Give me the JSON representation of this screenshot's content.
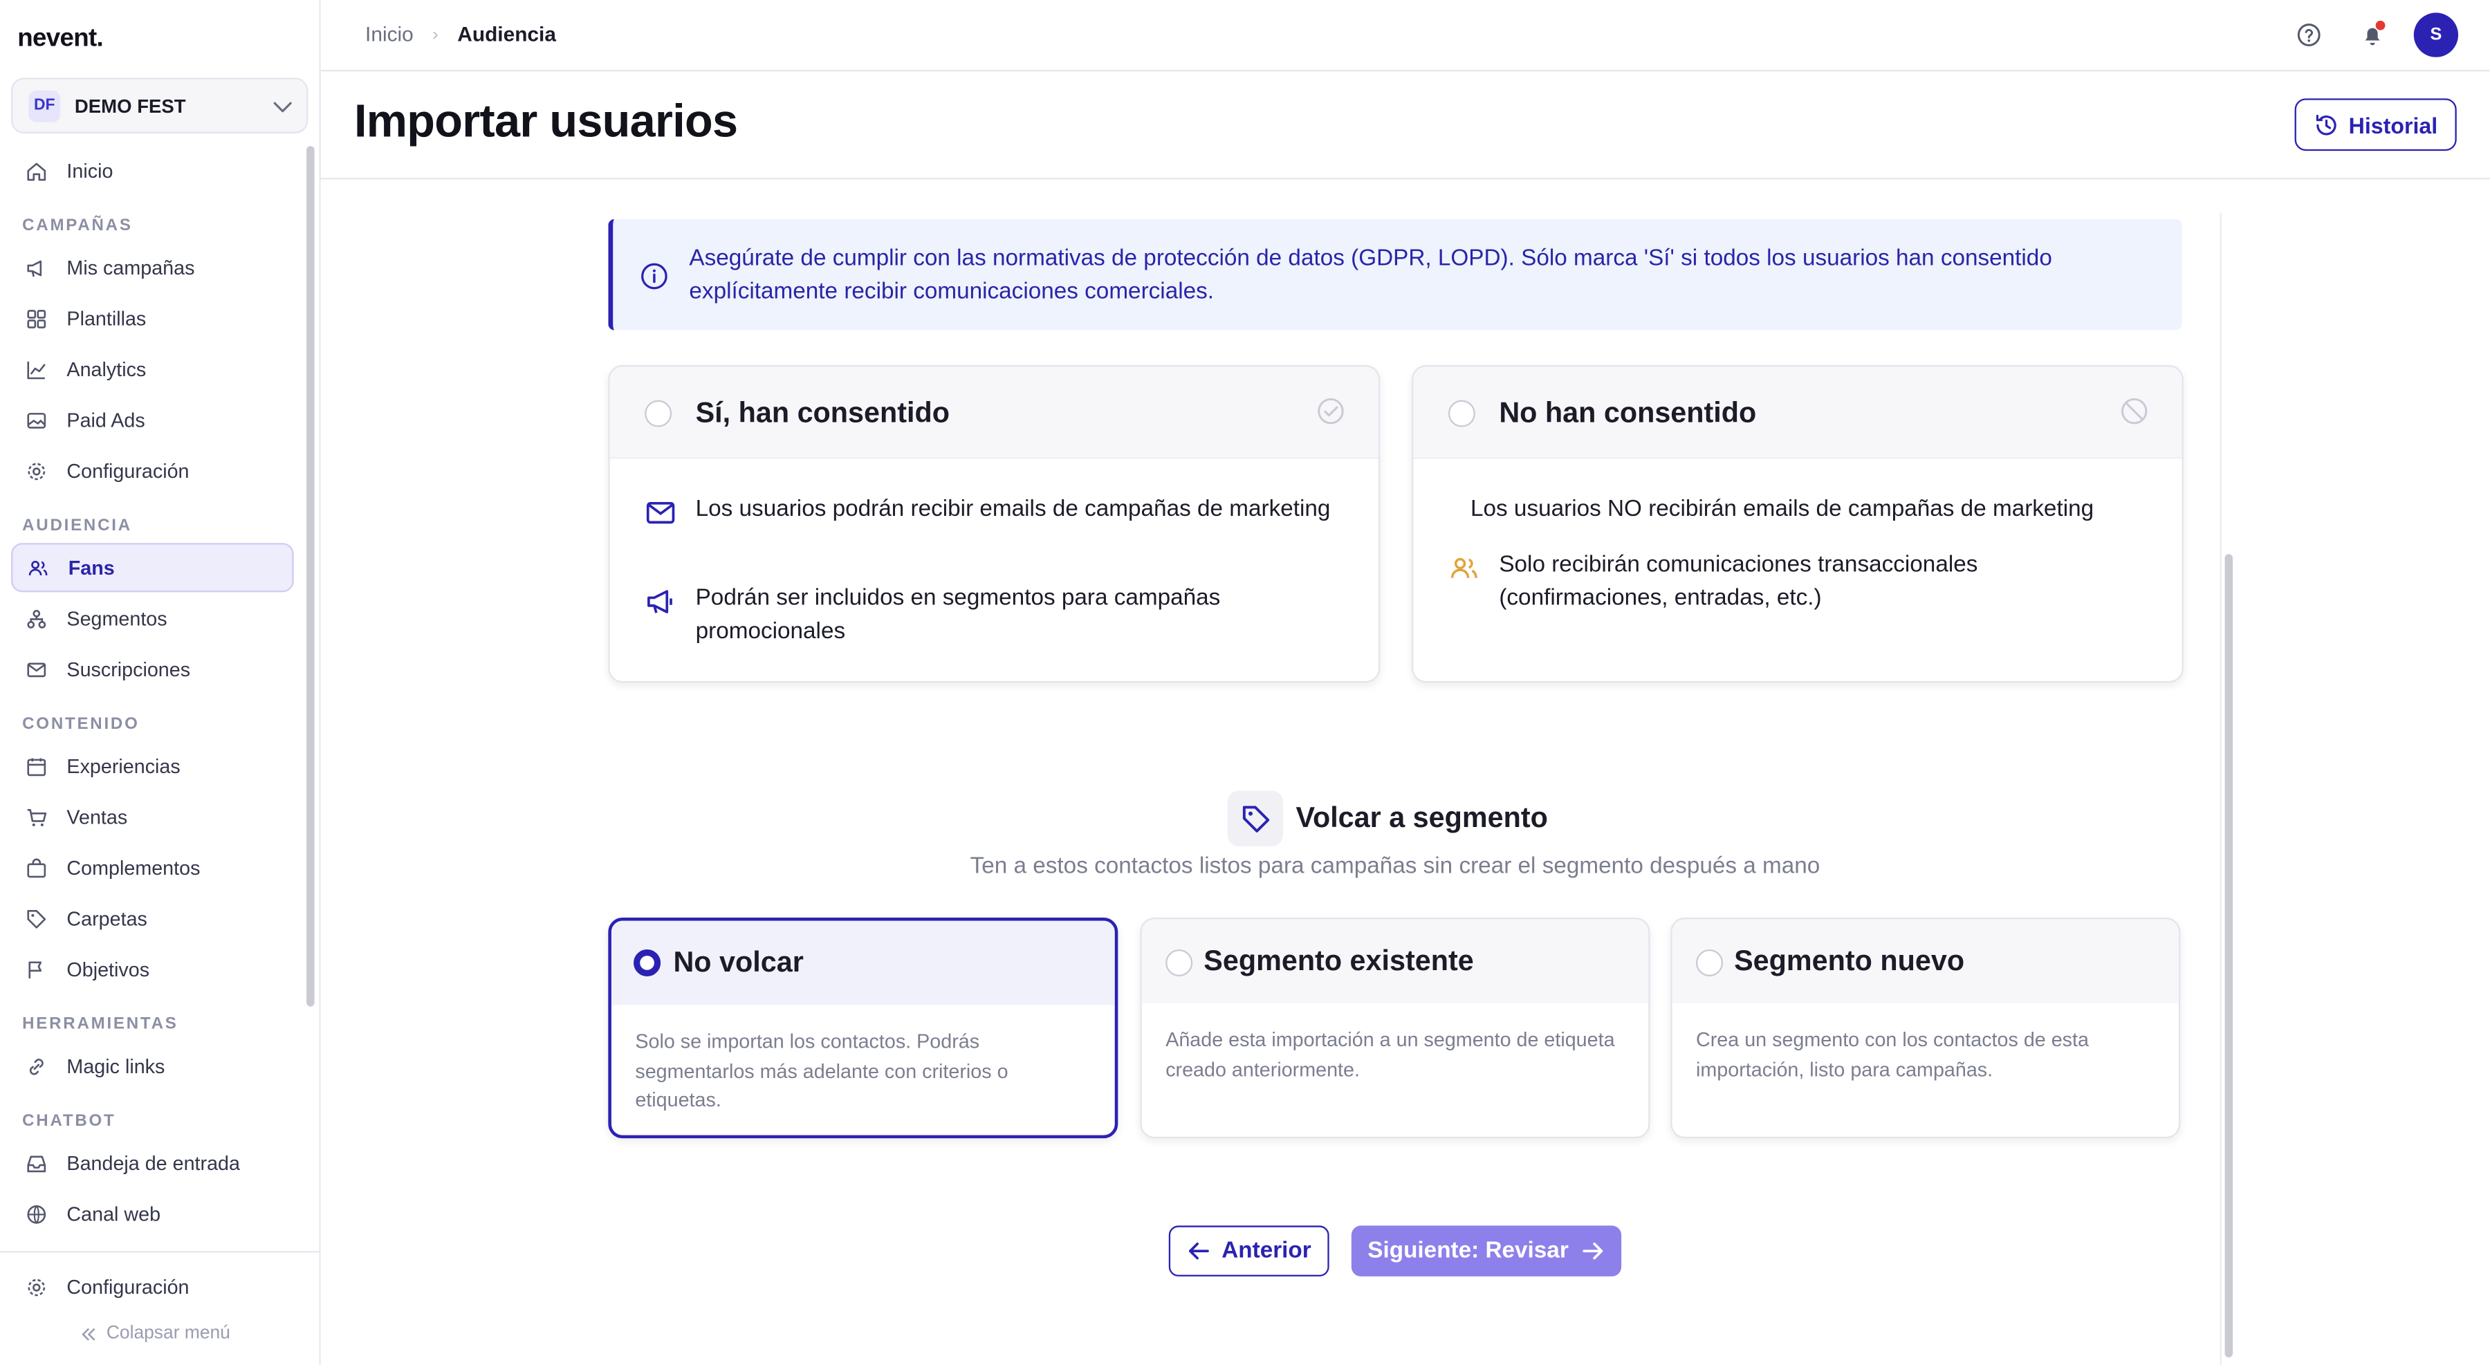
{
  "app": {
    "logo": "nevent."
  },
  "org": {
    "badge": "DF",
    "name": "DEMO FEST"
  },
  "sidebar": {
    "items_top": [
      {
        "label": "Inicio",
        "icon": "home-icon"
      }
    ],
    "sections": [
      {
        "title": "CAMPAÑAS",
        "items": [
          {
            "label": "Mis campañas",
            "icon": "megaphone-icon"
          },
          {
            "label": "Plantillas",
            "icon": "grid-icon"
          },
          {
            "label": "Analytics",
            "icon": "chart-line-icon"
          },
          {
            "label": "Paid Ads",
            "icon": "image-icon"
          },
          {
            "label": "Configuración",
            "icon": "gear-icon"
          }
        ]
      },
      {
        "title": "AUDIENCIA",
        "items": [
          {
            "label": "Fans",
            "icon": "users-icon",
            "active": true
          },
          {
            "label": "Segmentos",
            "icon": "segments-icon"
          },
          {
            "label": "Suscripciones",
            "icon": "mail-icon"
          }
        ]
      },
      {
        "title": "CONTENIDO",
        "items": [
          {
            "label": "Experiencias",
            "icon": "calendar-icon"
          },
          {
            "label": "Ventas",
            "icon": "cart-icon"
          },
          {
            "label": "Complementos",
            "icon": "bag-icon"
          },
          {
            "label": "Carpetas",
            "icon": "tag-icon"
          },
          {
            "label": "Objetivos",
            "icon": "flag-icon"
          }
        ]
      },
      {
        "title": "HERRAMIENTAS",
        "items": [
          {
            "label": "Magic links",
            "icon": "link-icon"
          }
        ]
      },
      {
        "title": "CHATBOT",
        "items": [
          {
            "label": "Bandeja de entrada",
            "icon": "inbox-icon"
          },
          {
            "label": "Canal web",
            "icon": "globe-icon"
          }
        ]
      }
    ],
    "footer_settings": "Configuración",
    "collapse_label": "Colapsar menú"
  },
  "breadcrumb": {
    "home": "Inicio",
    "separator": "›",
    "current": "Audiencia"
  },
  "user": {
    "avatar_initial": "S"
  },
  "header": {
    "title": "Importar usuarios",
    "history_button": "Historial"
  },
  "alert": {
    "text": "Asegúrate de cumplir con las normativas de protección de datos (GDPR, LOPD). Sólo marca 'Sí' si todos los usuarios han consentido explícitamente recibir comunicaciones comerciales."
  },
  "consent": {
    "yes": {
      "title": "Sí, han consentido",
      "row1": "Los usuarios podrán recibir emails de campañas de marketing",
      "row2": "Podrán ser incluidos en segmentos para campañas promocionales"
    },
    "no": {
      "title": "No han consentido",
      "row1": "Los usuarios NO recibirán emails de campañas de marketing",
      "row2": "Solo recibirán comunicaciones transaccionales (confirmaciones, entradas, etc.)"
    }
  },
  "segment": {
    "title": "Volcar a segmento",
    "subtitle": "Ten a estos contactos listos para campañas sin crear el segmento después a mano",
    "options": [
      {
        "title": "No volcar",
        "desc": "Solo se importan los contactos. Podrás segmentarlos más adelante con criterios o etiquetas.",
        "selected": true
      },
      {
        "title": "Segmento existente",
        "desc": "Añade esta importación a un segmento de etiqueta creado anteriormente.",
        "selected": false
      },
      {
        "title": "Segmento nuevo",
        "desc": "Crea un segmento con los contactos de esta importación, listo para campañas.",
        "selected": false
      }
    ]
  },
  "nav_buttons": {
    "prev": "Anterior",
    "next": "Siguiente: Revisar"
  },
  "colors": {
    "primary": "#2b22b3",
    "next_button": "#8e80ea",
    "alert_bg": "#eef3fd",
    "notif": "#e53935"
  }
}
